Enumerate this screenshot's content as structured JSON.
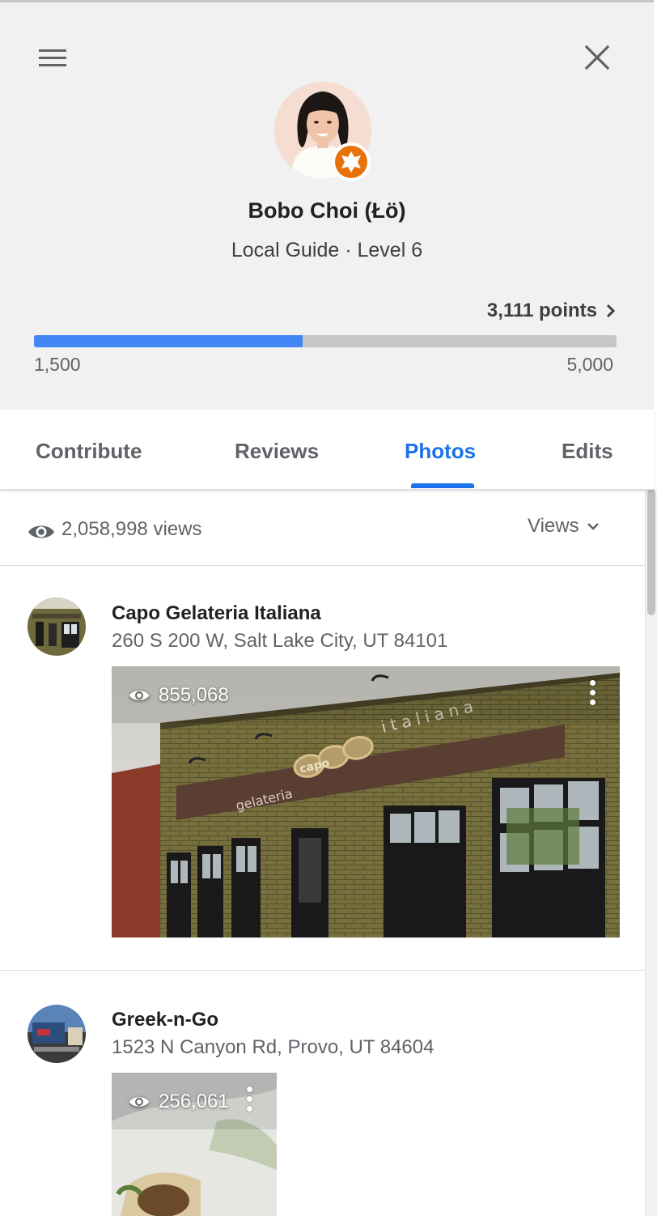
{
  "header": {
    "name": "Bobo Choi (Łö)",
    "level": "Local Guide · Level 6",
    "points": "3,111 points",
    "progress": {
      "min": "1,500",
      "max": "5,000",
      "fraction": 0.461
    }
  },
  "tabs": [
    {
      "label": "Contribute"
    },
    {
      "label": "Reviews"
    },
    {
      "label": "Photos",
      "active": true
    },
    {
      "label": "Edits"
    }
  ],
  "photos": {
    "total_views": "2,058,998 views",
    "sort_label": "Views",
    "items": [
      {
        "name": "Capo Gelateria Italiana",
        "address": "260 S 200 W, Salt Lake City, UT 84101",
        "views": "855,068",
        "sign_left": "gelateria",
        "sign_logo": "capo",
        "sign_right": "italiana"
      },
      {
        "name": "Greek-n-Go",
        "address": "1523 N Canyon Rd, Provo, UT 84604",
        "views": "256,061"
      }
    ]
  },
  "colors": {
    "accent": "#1a73e8",
    "progress": "#4285f4",
    "badge": "#e8710a"
  }
}
